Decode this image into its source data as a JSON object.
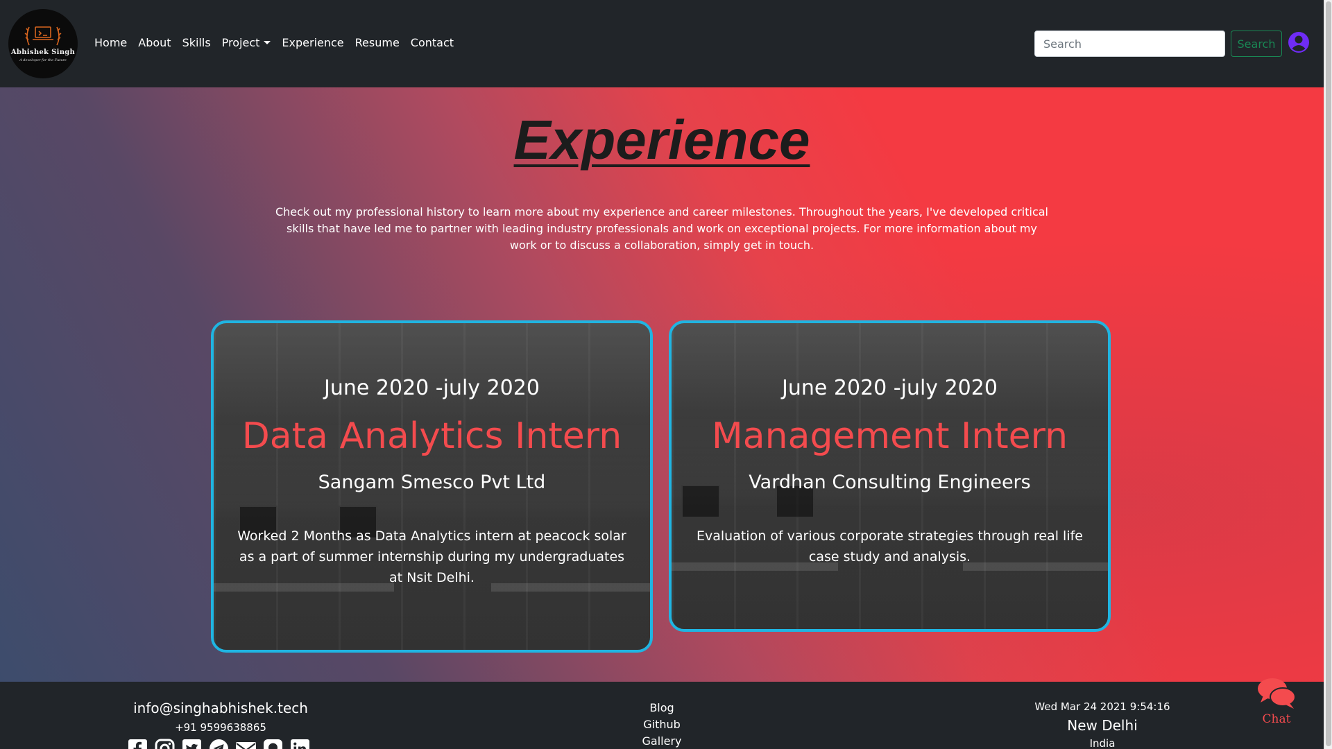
{
  "brand": {
    "name": "Abhishek Singh",
    "tagline": "A developer for the Future"
  },
  "nav": {
    "items": [
      {
        "label": "Home"
      },
      {
        "label": "About"
      },
      {
        "label": "Skills"
      },
      {
        "label": "Project"
      },
      {
        "label": "Experience"
      },
      {
        "label": "Resume"
      },
      {
        "label": "Contact"
      }
    ],
    "search_placeholder": "Search",
    "search_button": "Search",
    "user_icon": "user-circle-icon"
  },
  "experience": {
    "title": "Experience",
    "intro": "Check out my professional history to learn more about my experience and career milestones. Throughout the years, I've developed critical skills that have led me to partner with leading industry professionals and work on exceptional projects. For more information about my work or to discuss a collaboration, simply get in touch.",
    "cards": [
      {
        "date": "June 2020 -july 2020",
        "role": "Data Analytics Intern",
        "company": "Sangam Smesco Pvt Ltd",
        "description": "Worked 2 Months as Data Analytics intern at peacock solar as a part of summer internship during my undergraduates at Nsit Delhi."
      },
      {
        "date": "June 2020 -july 2020",
        "role": "Management Intern",
        "company": "Vardhan Consulting Engineers",
        "description": "Evaluation of various corporate strategies through real life case study and analysis."
      }
    ]
  },
  "footer": {
    "email": "info@singhabhishek.tech",
    "phone": "+91 9599638865",
    "social_icons": [
      "facebook-icon",
      "instagram-icon",
      "twitter-icon",
      "telegram-icon",
      "email-icon",
      "github-icon",
      "linkedin-icon"
    ],
    "links": [
      "Blog",
      "Github",
      "Gallery"
    ],
    "datetime": "Wed Mar 24 2021 9:54:16",
    "city": "New Delhi",
    "country": "India"
  },
  "chat": {
    "label": "Chat"
  },
  "colors": {
    "navbar_bg": "#212529",
    "card_border": "#1fb5e2",
    "role_color": "#f44b4e",
    "search_green": "#198754",
    "user_icon": "#6f2cf5"
  }
}
